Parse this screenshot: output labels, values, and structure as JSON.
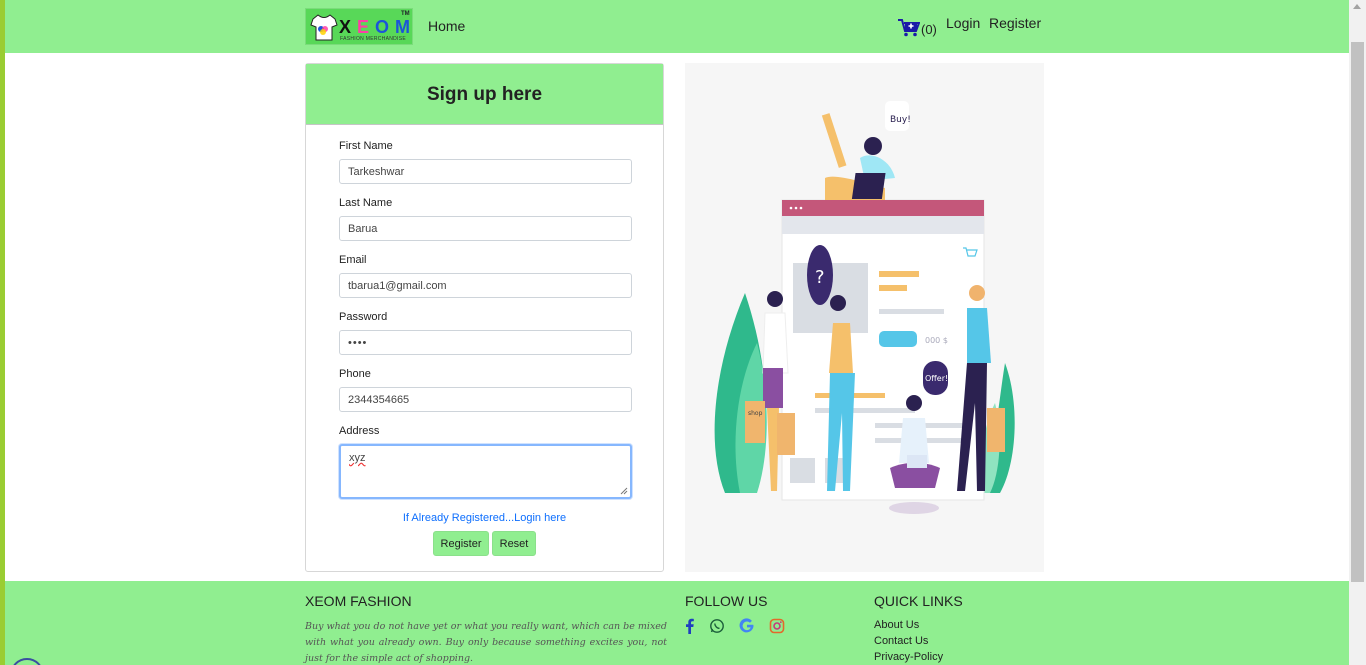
{
  "navbar": {
    "brand": {
      "letters": [
        "X",
        "E",
        "O",
        "M"
      ],
      "tagline": "FASHION MERCHANDISE",
      "tm": "TM"
    },
    "home_label": "Home",
    "cart_count": "(0)",
    "login_label": "Login",
    "register_label": "Register",
    "cart_icon": "cart-plus-icon"
  },
  "form": {
    "title": "Sign up here",
    "fields": [
      {
        "label": "First Name",
        "value": "Tarkeshwar"
      },
      {
        "label": "Last Name",
        "value": "Barua"
      },
      {
        "label": "Email",
        "value": "tbarua1@gmail.com"
      },
      {
        "label": "Password",
        "value": "••••"
      },
      {
        "label": "Phone",
        "value": "2344354665"
      },
      {
        "label": "Address",
        "value": "xyz"
      }
    ],
    "login_link": "If Already Registered...Login here",
    "register_button": "Register",
    "reset_button": "Reset"
  },
  "illustration": {
    "bubble_buy": "Buy!",
    "bubble_question": "?",
    "bubble_offer": "Offer!",
    "price_tag": "000 $",
    "bag_label": "shop"
  },
  "footer": {
    "about": {
      "title": "XEOM FASHION",
      "text": "Buy what you do not have yet or what you really want, which can be mixed with what you already own. Buy only because something excites you, not just for the simple act of shopping."
    },
    "follow": {
      "title": "FOLLOW US",
      "icons": [
        "facebook-icon",
        "whatsapp-icon",
        "google-icon",
        "instagram-icon"
      ]
    },
    "quick_links": {
      "title": "QUICK LINKS",
      "links": [
        "About Us",
        "Contact Us",
        "Privacy-Policy"
      ]
    }
  },
  "colors": {
    "accent_green": "#90ee90",
    "link_blue": "#0d6efd",
    "frame_green": "#9acd32"
  }
}
